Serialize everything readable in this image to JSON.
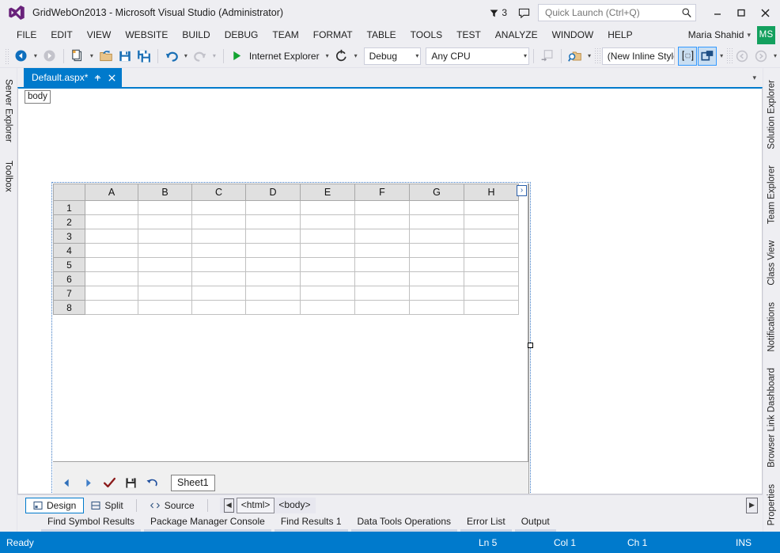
{
  "titlebar": {
    "app_title": "GridWebOn2013 - Microsoft Visual Studio (Administrator)",
    "logo_name": "visual-studio-logo",
    "warning_count": "3",
    "feedback_icon": "feedback-icon",
    "quick_launch_placeholder": "Quick Launch (Ctrl+Q)",
    "quick_launch_value": "",
    "minimize_label": "–",
    "maximize_label": "□",
    "close_label": "✕"
  },
  "menubar": {
    "items": [
      {
        "label": "FILE"
      },
      {
        "label": "EDIT"
      },
      {
        "label": "VIEW"
      },
      {
        "label": "WEBSITE"
      },
      {
        "label": "BUILD"
      },
      {
        "label": "DEBUG"
      },
      {
        "label": "TEAM"
      },
      {
        "label": "FORMAT"
      },
      {
        "label": "TABLE"
      },
      {
        "label": "TOOLS"
      },
      {
        "label": "TEST"
      },
      {
        "label": "ANALYZE"
      },
      {
        "label": "WINDOW"
      },
      {
        "label": "HELP"
      }
    ],
    "user_name": "Maria Shahid",
    "user_caret": "▾",
    "avatar_initials": "MS",
    "avatar_color": "#13a05e"
  },
  "toolbar": {
    "navigate_back": "navigate-back-icon",
    "navigate_forward": "navigate-forward-icon",
    "new_project": "new-project-icon",
    "open_file": "open-folder-icon",
    "save": "save-icon",
    "save_all": "save-all-icon",
    "undo": "undo-icon",
    "redo": "redo-icon",
    "start_debug_label": "Internet Explorer",
    "refresh": "refresh-icon",
    "configuration_value": "Debug",
    "platform_value": "Any CPU",
    "step_into_icon": "step-into-icon",
    "find_in_files_icon": "find-in-files-icon",
    "style_select_value": "(New Inline Style",
    "toggle_selection_icon": "selection-tag-icon",
    "toggle_expand_icon": "expand-overlay-icon",
    "prev_icon": "arrow-prev-icon",
    "next_icon": "arrow-next-icon",
    "caret": "▾"
  },
  "left_rail": {
    "items": [
      {
        "label": "Server Explorer"
      },
      {
        "label": "Toolbox"
      }
    ]
  },
  "right_rail": {
    "items": [
      {
        "label": "Solution Explorer"
      },
      {
        "label": "Team Explorer"
      },
      {
        "label": "Class View"
      },
      {
        "label": "Notifications"
      },
      {
        "label": "Browser Link Dashboard"
      },
      {
        "label": "Properties"
      }
    ]
  },
  "document_tab": {
    "title": "Default.aspx*",
    "pin_icon": "pin-icon",
    "close_icon": "close-icon",
    "overflow_caret": "▾",
    "accent_color": "#007acc"
  },
  "designer": {
    "body_badge": "body",
    "expand_chevron": "›",
    "grid": {
      "columns": [
        "A",
        "B",
        "C",
        "D",
        "E",
        "F",
        "G",
        "H"
      ],
      "rows": [
        "1",
        "2",
        "3",
        "4",
        "5",
        "6",
        "7",
        "8"
      ],
      "cells": [
        [
          "",
          "",
          "",
          "",
          "",
          "",
          "",
          ""
        ],
        [
          "",
          "",
          "",
          "",
          "",
          "",
          "",
          ""
        ],
        [
          "",
          "",
          "",
          "",
          "",
          "",
          "",
          ""
        ],
        [
          "",
          "",
          "",
          "",
          "",
          "",
          "",
          ""
        ],
        [
          "",
          "",
          "",
          "",
          "",
          "",
          "",
          ""
        ],
        [
          "",
          "",
          "",
          "",
          "",
          "",
          "",
          ""
        ],
        [
          "",
          "",
          "",
          "",
          "",
          "",
          "",
          ""
        ],
        [
          "",
          "",
          "",
          "",
          "",
          "",
          "",
          ""
        ]
      ],
      "header_bg": "#e0e0e0",
      "gridline_color": "#c0c0c0"
    },
    "sheet_bar": {
      "prev_icon": "sheet-prev-icon",
      "next_icon": "sheet-next-icon",
      "submit_icon": "submit-check-icon",
      "save_icon": "save-floppy-icon",
      "undo_icon": "undo-arrow-icon",
      "sheet_tab_label": "Sheet1"
    }
  },
  "view_bar": {
    "tabs": [
      {
        "label": "Design",
        "icon": "design-view-icon",
        "selected": true
      },
      {
        "label": "Split",
        "icon": "split-view-icon",
        "selected": false
      },
      {
        "label": "Source",
        "icon": "source-view-icon",
        "selected": false
      }
    ],
    "tag_nav": {
      "left_arrow": "◀",
      "right_arrow": "▶",
      "tags": [
        {
          "label": "<html>",
          "boxed": true
        },
        {
          "label": "<body>",
          "boxed": false
        }
      ]
    }
  },
  "bottom_tabs": {
    "items": [
      {
        "label": "Find Symbol Results"
      },
      {
        "label": "Package Manager Console"
      },
      {
        "label": "Find Results 1"
      },
      {
        "label": "Data Tools Operations"
      },
      {
        "label": "Error List"
      },
      {
        "label": "Output"
      }
    ]
  },
  "statusbar": {
    "status": "Ready",
    "line": "Ln 5",
    "column": "Col 1",
    "character": "Ch 1",
    "insert_mode": "INS",
    "background_color": "#007acc"
  }
}
